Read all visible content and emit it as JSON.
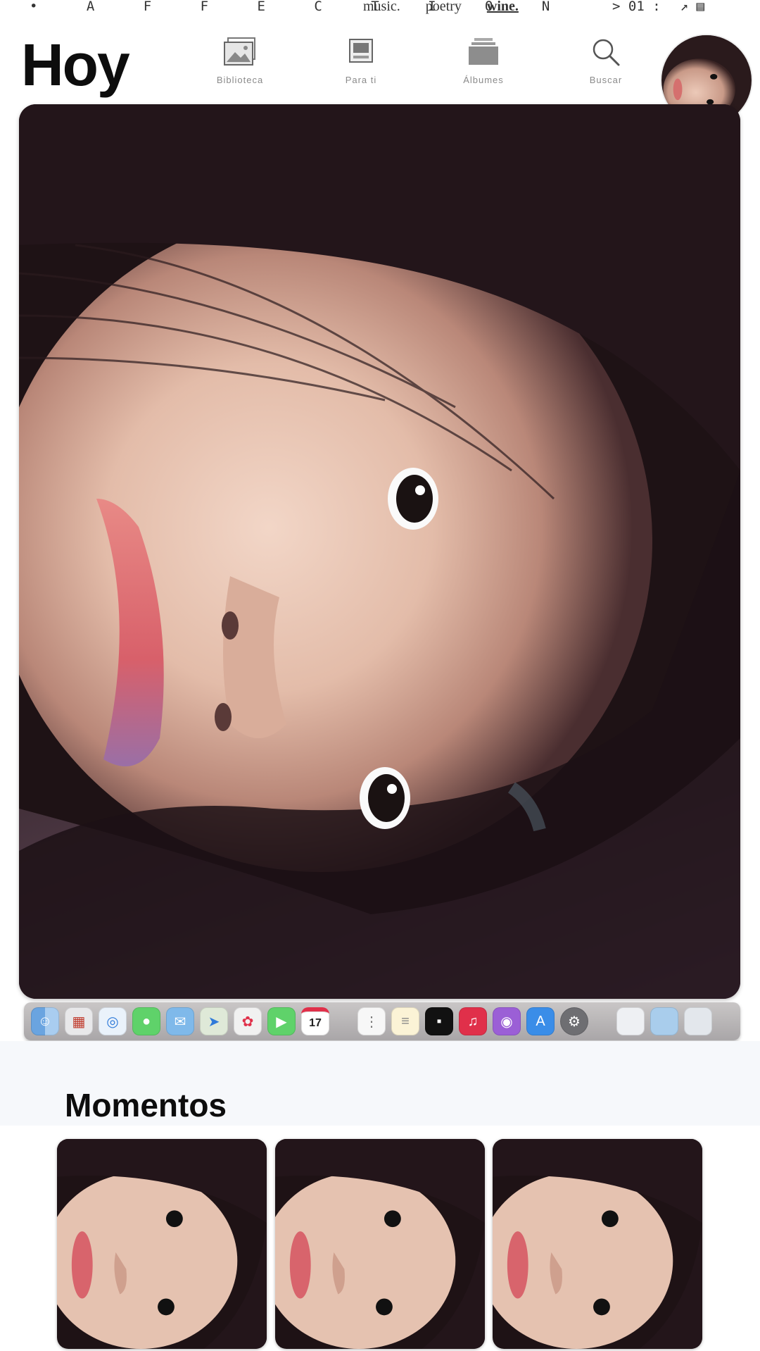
{
  "statusbar": {
    "brand": "• A F F E C T I O N",
    "items": [
      "music.",
      "poetry",
      "wine."
    ],
    "clock": "> 01 :",
    "glyphs": "↗ ▤"
  },
  "header": {
    "title": "Hoy",
    "nav": [
      {
        "label": "Biblioteca",
        "icon": "photos-icon"
      },
      {
        "label": "Para ti",
        "icon": "album-icon"
      },
      {
        "label": "Álbumes",
        "icon": "stack-icon"
      },
      {
        "label": "Buscar",
        "icon": "search-icon"
      }
    ]
  },
  "dock": {
    "calendar_day": "17",
    "icons": [
      "finder",
      "launchpad",
      "safari",
      "messages",
      "mail",
      "maps",
      "photos",
      "facetime",
      "calendar",
      "notes",
      "reminders",
      "tv",
      "music",
      "podcasts",
      "appstore",
      "settings",
      "folder",
      "downloads",
      "trash"
    ]
  },
  "momentos": {
    "title": "Momentos",
    "count_visible": 3
  },
  "colors": {
    "background": "#ffffff",
    "title": "#0d0d0d",
    "nav_label": "#8a8a8a",
    "music_red": "#e0304a"
  }
}
